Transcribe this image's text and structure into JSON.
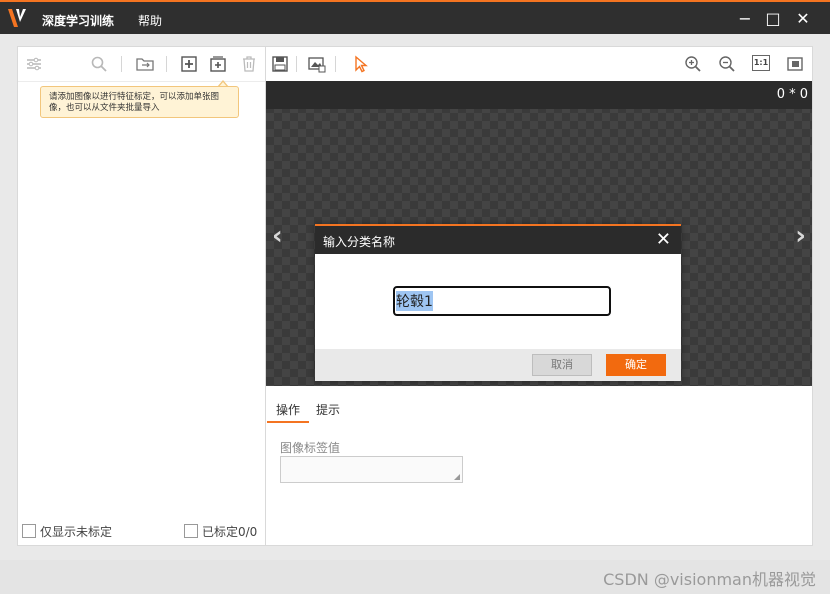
{
  "app": {
    "title": "深度学习训练",
    "menu_help": "帮助",
    "accent_color": "#f47421"
  },
  "window_controls": {
    "minimize": "−",
    "maximize": "□",
    "close": "✕"
  },
  "left_toolbar": {
    "icons": [
      "filter-icon",
      "search-icon",
      "folder-move-icon",
      "add-image-icon",
      "add-multiple-icon",
      "delete-icon"
    ]
  },
  "tooltip": {
    "text": "请添加图像以进行特征标定，可以添加单张图像，也可以从文件夹批量导入"
  },
  "left_footer": {
    "only_unlabeled": "仅显示未标定",
    "labeled_count": "已标定0/0"
  },
  "right_toolbar": {
    "icons": [
      "save-icon",
      "image-import-icon",
      "pointer-icon",
      "zoom-in-icon",
      "zoom-out-icon",
      "actual-size-icon",
      "fit-window-icon"
    ],
    "actual_size_label": "1:1"
  },
  "canvas": {
    "image_size": "0 * 0",
    "prev_arrow": "‹",
    "next_arrow": "›"
  },
  "dialog": {
    "title": "输入分类名称",
    "close": "✕",
    "input_value": "轮毂1",
    "cancel_label": "取消",
    "ok_label": "确定"
  },
  "tabs": [
    {
      "label": "操作"
    },
    {
      "label": "提示"
    }
  ],
  "properties": {
    "tag_label": "图像标签值"
  },
  "watermark": "CSDN @visionman机器视觉"
}
